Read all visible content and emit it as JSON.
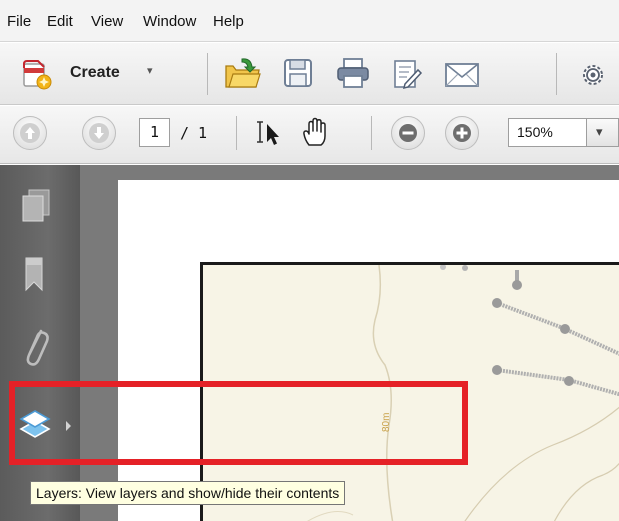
{
  "menubar": {
    "items": [
      "File",
      "Edit",
      "View",
      "Window",
      "Help"
    ]
  },
  "toolbar": {
    "create_label": "Create",
    "create_caret": "▾",
    "icons": [
      "create-pdf-icon",
      "open-folder-icon",
      "save-icon",
      "print-icon",
      "edit-document-icon",
      "email-icon",
      "settings-gear-icon"
    ]
  },
  "navigation": {
    "current_page": "1",
    "total_pages": "/ 1",
    "zoom": "150%",
    "zoom_caret": "▾",
    "icons": [
      "previous-page-icon",
      "next-page-icon",
      "select-cursor-icon",
      "hand-tool-icon",
      "zoom-out-icon",
      "zoom-in-icon"
    ]
  },
  "nav_pane": {
    "icons": [
      "page-thumbnails-icon",
      "bookmarks-icon",
      "attachments-icon",
      "layers-icon"
    ]
  },
  "document": {
    "map_label": "80m"
  },
  "tooltip": {
    "text": "Layers: View layers and show/hide their contents"
  },
  "colors": {
    "highlight": "#e52127",
    "nav_pane": "#636363",
    "map_background": "#f7f4e6"
  }
}
